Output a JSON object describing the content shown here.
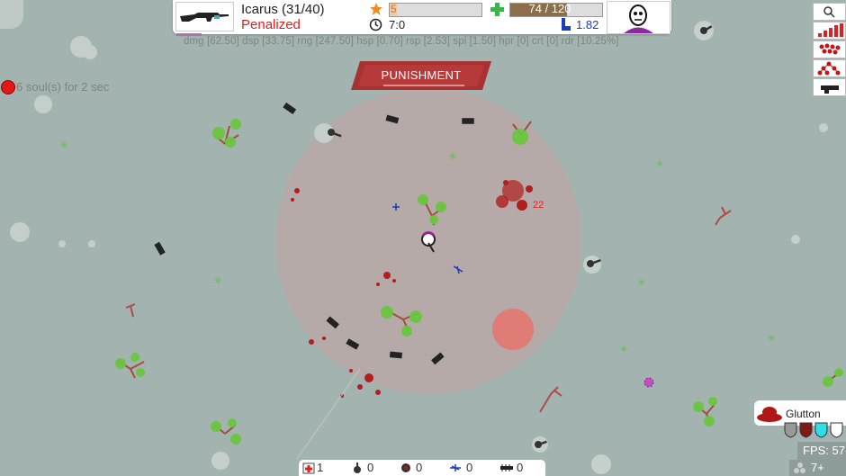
{
  "hud": {
    "weapon_name": "Icarus (31/40)",
    "weapon_status": "Penalized",
    "level_value": "5",
    "level_fraction": 0.08,
    "hp_text": "74 / 120",
    "hp_fraction": 0.62,
    "time_text": "7:0",
    "speed_text": "1.82"
  },
  "stats_line": "dmg [62.50] dsp [33.75] rng [247.50] hsp [0.70] rsp [2.53] spl [1.50] hpr [0] crt [0] rdr [10.25%]",
  "souls_text": "6 soul(s) for 2 sec",
  "banner": {
    "text": "PUNISHMENT"
  },
  "damage_popup": "22",
  "tools": [
    {
      "icon": "magnifier-icon"
    },
    {
      "icon": "signal-bars-icon"
    },
    {
      "icon": "cluster-icon"
    },
    {
      "icon": "tree-icon"
    },
    {
      "icon": "turret-icon"
    }
  ],
  "bottom_counts": {
    "medkit": "1",
    "turret": "0",
    "mine": "0",
    "drone": "0",
    "ant": "0"
  },
  "perk": {
    "label": "Glutton",
    "shields": [
      "gray",
      "darkred",
      "cyan",
      "white"
    ]
  },
  "fps_text": "FPS: 57",
  "more_text": "7+",
  "colors": {
    "ground": "#a3b4b0",
    "danger_zone": "#c0a9a8",
    "blood": "#b21d1d",
    "accent_red": "#e02020",
    "speed_blue": "#1a3cc0"
  }
}
